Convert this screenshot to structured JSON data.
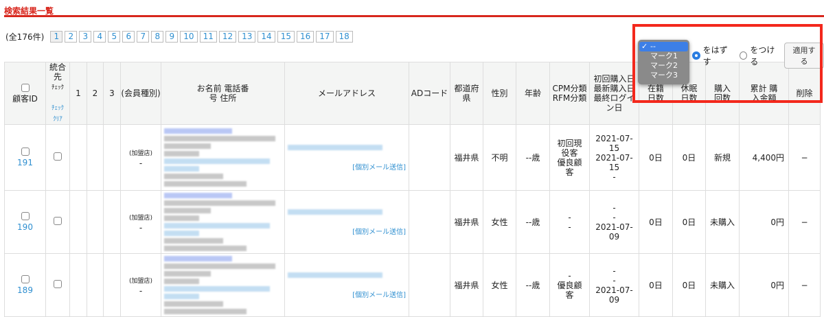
{
  "title": "検索結果一覧",
  "pager": {
    "count": "(全176件)",
    "pages": [
      "1",
      "2",
      "3",
      "4",
      "5",
      "6",
      "7",
      "8",
      "9",
      "10",
      "11",
      "12",
      "13",
      "14",
      "15",
      "16",
      "17",
      "18"
    ]
  },
  "headers": {
    "customer_id": "顧客ID",
    "merge": "統合先",
    "check": "ﾁｪｯｸ",
    "check_link": "ﾁｪｯｸ",
    "clear_link": "ｸﾘｱ",
    "c1": "1",
    "c2": "2",
    "c3": "3",
    "member_type": "(会員種別)",
    "name": "お名前 電話番号 住所",
    "email": "メールアドレス",
    "ad": "ADコード",
    "pref": "都道府県",
    "gender": "性別",
    "age": "年齢",
    "cpm": "CPM分類 RFM分類",
    "dates": "初回購入日 最新購入日 最終ログイン日",
    "tenure": "在籍日数",
    "dormant": "休眠日数",
    "purchases": "購入回数",
    "total": "累計 購入金額",
    "delete": "削除"
  },
  "rows": [
    {
      "id": "191",
      "member_type": "(加盟店)",
      "member_sub": "-",
      "mail_link": "[個別メール送信]",
      "pref": "福井県",
      "gender": "不明",
      "age": "--歳",
      "cpm": "初回現役客",
      "rfm": "優良顧客",
      "first": "2021-07-15",
      "latest": "2021-07-15",
      "login": "-",
      "tenure": "0日",
      "dormant": "0日",
      "purchases": "新規",
      "total": "4,400円",
      "delete": "−"
    },
    {
      "id": "190",
      "member_type": "(加盟店)",
      "member_sub": "-",
      "mail_link": "[個別メール送信]",
      "pref": "福井県",
      "gender": "女性",
      "age": "--歳",
      "cpm": "-",
      "rfm": "-",
      "first": "-",
      "latest": "-",
      "login": "2021-07-09",
      "tenure": "0日",
      "dormant": "0日",
      "purchases": "未購入",
      "total": "0円",
      "delete": "−"
    },
    {
      "id": "189",
      "member_type": "(加盟店)",
      "member_sub": "-",
      "mail_link": "[個別メール送信]",
      "pref": "福井県",
      "gender": "女性",
      "age": "--歳",
      "cpm": "-",
      "rfm": "優良顧客",
      "first": "-",
      "latest": "-",
      "login": "2021-07-09",
      "tenure": "0日",
      "dormant": "0日",
      "purchases": "未購入",
      "total": "0円",
      "delete": "−"
    }
  ],
  "mark": {
    "options": [
      "--",
      "マーク1",
      "マーク2",
      "マーク3"
    ],
    "selected": "--",
    "remove": "をはずす",
    "add": "をつける",
    "apply": "適用する",
    "mode": "remove"
  },
  "colors": {
    "accent": "#d8261c",
    "link": "#2f8fd0",
    "highlight": "#f3281c"
  }
}
